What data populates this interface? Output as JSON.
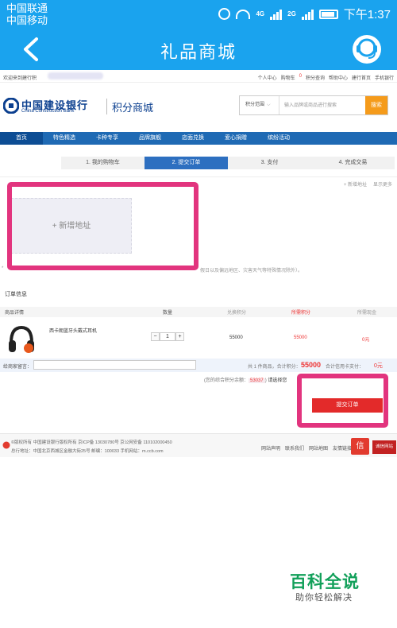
{
  "statusbar": {
    "carrier1": "中国联通",
    "carrier2": "中国移动",
    "net1": "4G",
    "net2": "2G",
    "time": "下午1:37"
  },
  "app": {
    "title": "礼品商城"
  },
  "toplinks": {
    "welcome": "欢迎来到建行积",
    "items": [
      "个人中心",
      "购物车",
      "0",
      "积分查询",
      "帮助中心",
      "建行首页",
      "手机银行"
    ]
  },
  "brand": {
    "cn": "中国建设银行",
    "en": "China Construction Bank",
    "sub": "积分商城"
  },
  "search": {
    "scope": "积分范围",
    "placeholder": "输入品牌或商品进行搜索",
    "button": "搜索"
  },
  "nav": [
    "首页",
    "特色精选",
    "卡种专享",
    "品牌旗舰",
    "店面兑换",
    "爱心捐赠",
    "缤纷活动"
  ],
  "steps": [
    "1. 我的购物车",
    "2. 提交订单",
    "3. 支付",
    "4. 完成交易"
  ],
  "address": {
    "links": [
      "+ 新增地址",
      "显示更多"
    ],
    "add_card": "+ 新增地址",
    "notice_prefix": "*",
    "notice_tail": "假日以及偏远地区、灾害天气等特殊情况除外）。"
  },
  "order": {
    "title": "订单信息",
    "headers": [
      "商品详情",
      "数量",
      "兑换积分",
      "所需积分",
      "所需现金"
    ],
    "product": {
      "name": "西卡朗蓝牙头戴式耳机",
      "qty_minus": "−",
      "qty": "1",
      "qty_plus": "+",
      "points": "55000",
      "need_points": "55000",
      "cash": "0元"
    },
    "message_label": "给商家留言：",
    "summary_text": "共 1 件商品，合计积分：",
    "summary_points": "55000",
    "summary_cash_text": "合计信用卡支付：",
    "summary_cash": "0元",
    "balance_text": "(您的综合积分余额：",
    "balance": "53037",
    "balance_end": ")",
    "confirm": "请选择您",
    "submit": "提交订单"
  },
  "footer": {
    "line1": "©版权所有 中国建设银行版权所有 京ICP备 13030780号 京公网安备 110102000450",
    "line2": "总行地址：中国北京西城区金融大街25号 邮编：100033 手机网站：m.ccb.com",
    "links": [
      "网站声明",
      "联系我们",
      "网站地图",
      "友情链接"
    ],
    "badge1": "信",
    "badge2": "诚信网站"
  },
  "watermark": {
    "title": "百科全说",
    "subtitle": "助你轻松解决"
  },
  "colors": {
    "app_blue": "#1aa3ee",
    "nav_blue": "#1f6ab4",
    "highlight": "#e2347e",
    "submit_red": "#e32a2a",
    "search_orange": "#f59b1b"
  }
}
